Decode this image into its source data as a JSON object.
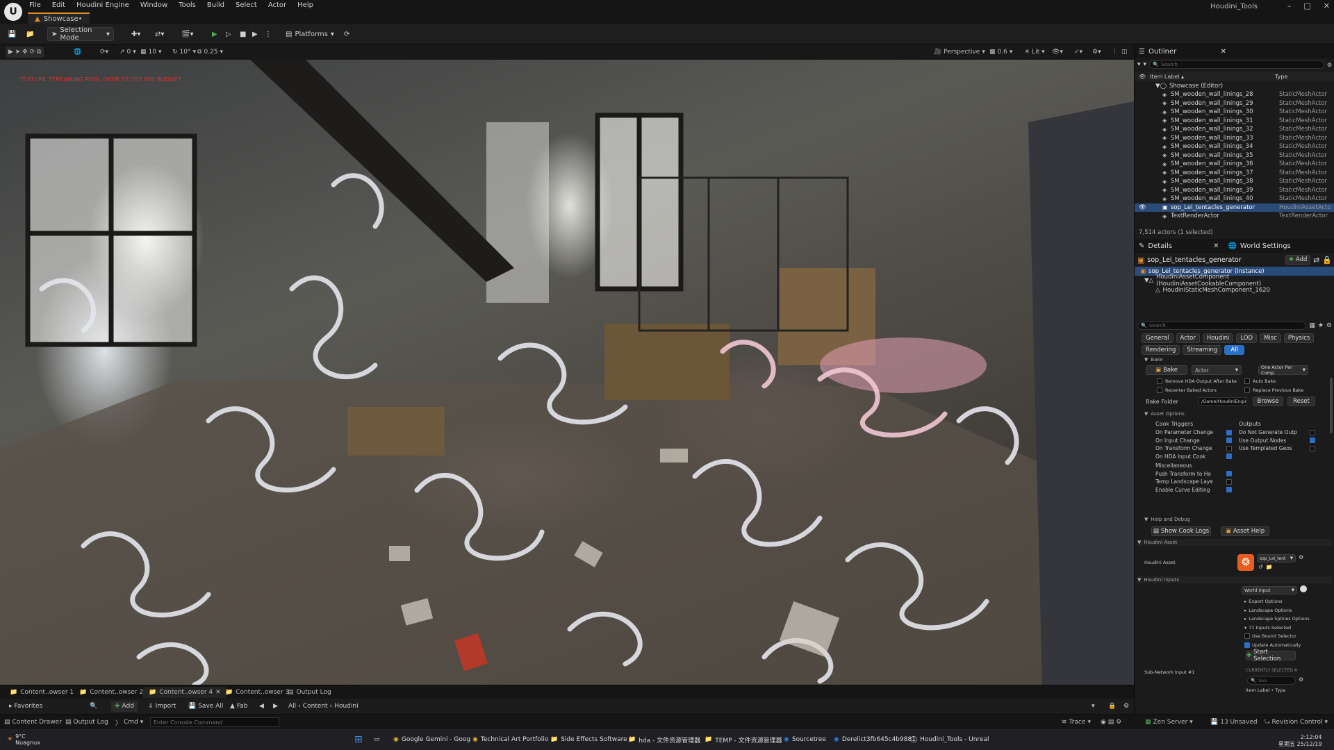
{
  "menubar": {
    "menus": [
      "File",
      "Edit",
      "Houdini Engine",
      "Window",
      "Tools",
      "Build",
      "Select",
      "Actor",
      "Help"
    ],
    "doc_tab": "Showcase•",
    "project": "Houdini_Tools"
  },
  "toolbar": {
    "selection_mode": "Selection Mode",
    "platforms": "Platforms"
  },
  "viewport_toolbar": {
    "grid": "10",
    "rot": "10°",
    "scale": "0.25",
    "translate": "0",
    "perspective": "Perspective",
    "speed": "0.6",
    "lit": "Lit"
  },
  "viewport": {
    "warning": "TEXTURE STREAMING POOL OVER 55.703 MiB BUDGET"
  },
  "bottom_tabs": [
    "Content..owser 1",
    "Content..owser 2",
    "Content..owser 4",
    "Content..owser 3",
    "Output Log"
  ],
  "content_bar": {
    "favorites": "Favorites",
    "add": "Add",
    "import": "Import",
    "save_all": "Save All",
    "fab": "Fab",
    "path": [
      "All",
      "Content",
      "Houdini"
    ]
  },
  "status": {
    "content_drawer": "Content Drawer",
    "output_log": "Output Log",
    "cmd": "Cmd",
    "console_placeholder": "Enter Console Command",
    "trace": "Trace",
    "zen": "Zen Server",
    "unsaved": "13 Unsaved",
    "revision": "Revision Control"
  },
  "taskbar": {
    "weather_temp": "9°C",
    "weather_place": "Nuagnux",
    "apps": [
      "Google Gemini - Goog",
      "Technical Art Portfolio",
      "Side Effects Software -",
      "hda - 文件资源管理器",
      "TEMP - 文件资源管理器",
      "Sourcetree",
      "Derelict3fb645c4b9881",
      "Houdini_Tools - Unreal"
    ],
    "time": "2:12:04",
    "date": "星期五 25/12/19"
  },
  "outliner": {
    "title": "Outliner",
    "search_placeholder": "Search",
    "col_label": "Item Label ▴",
    "col_type": "Type",
    "root": "Showcase (Editor)",
    "rows": [
      {
        "name": "SM_wooden_wall_linings_28",
        "type": "StaticMeshActor"
      },
      {
        "name": "SM_wooden_wall_linings_29",
        "type": "StaticMeshActor"
      },
      {
        "name": "SM_wooden_wall_linings_30",
        "type": "StaticMeshActor"
      },
      {
        "name": "SM_wooden_wall_linings_31",
        "type": "StaticMeshActor"
      },
      {
        "name": "SM_wooden_wall_linings_32",
        "type": "StaticMeshActor"
      },
      {
        "name": "SM_wooden_wall_linings_33",
        "type": "StaticMeshActor"
      },
      {
        "name": "SM_wooden_wall_linings_34",
        "type": "StaticMeshActor"
      },
      {
        "name": "SM_wooden_wall_linings_35",
        "type": "StaticMeshActor"
      },
      {
        "name": "SM_wooden_wall_linings_36",
        "type": "StaticMeshActor"
      },
      {
        "name": "SM_wooden_wall_linings_37",
        "type": "StaticMeshActor"
      },
      {
        "name": "SM_wooden_wall_linings_38",
        "type": "StaticMeshActor"
      },
      {
        "name": "SM_wooden_wall_linings_39",
        "type": "StaticMeshActor"
      },
      {
        "name": "SM_wooden_wall_linings_40",
        "type": "StaticMeshActor"
      },
      {
        "name": "sop_Lei_tentacles_generator",
        "type": "HoudiniAssetActo"
      },
      {
        "name": "TextRenderActor",
        "type": "TextRenderActor"
      }
    ],
    "count": "7,514 actors (1 selected)"
  },
  "details": {
    "tab": "Details",
    "tab2": "World Settings",
    "actor": "sop_Lei_tentacles_generator",
    "add": "Add",
    "instance": "sop_Lei_tentacles_generator (Instance)",
    "comp1": "HoudiniAssetComponent (HoudiniAssetCookableComponent)",
    "comp2": "HoudiniStaticMeshComponent_1620",
    "search_placeholder": "Search",
    "filters": [
      "General",
      "Actor",
      "Houdini",
      "LOD",
      "Misc",
      "Physics",
      "Rendering",
      "Streaming",
      "All"
    ],
    "bake": {
      "section": "Bake",
      "button": "Bake",
      "target": "Actor",
      "mode": "One Actor Per Comp",
      "remove": "Remove HDA Output After Bake",
      "auto": "Auto Bake",
      "recenter": "Recenter Baked Actors",
      "replace": "Replace Previous Bake",
      "folder_label": "Bake Folder",
      "folder": "/Game/HoudiniEngin",
      "browse": "Browse",
      "reset": "Reset"
    },
    "asset_options": {
      "section": "Asset Options",
      "cook_triggers": "Cook Triggers",
      "outputs": "Outputs",
      "left": [
        "On Parameter Change",
        "On Input Change",
        "On Transform Change",
        "On HDA Input Cook"
      ],
      "right": [
        "Do Not Generate Outp",
        "Use Output Nodes",
        "Use Templated Geos"
      ],
      "misc": "Miscellaneous",
      "misc_items": [
        "Push Transform to Ho",
        "Temp Landscape Laye",
        "Enable Curve Editing"
      ]
    },
    "help": {
      "section": "Help and Debug",
      "cook_logs": "Show Cook Logs",
      "asset_help": "Asset Help"
    },
    "houdini_asset": {
      "section": "Houdini Asset",
      "label": "Houdini Asset",
      "value": "sop_Lei_tent"
    },
    "inputs": {
      "section": "Houdini Inputs",
      "type": "World Input",
      "items": [
        "Export Options",
        "Landscape Options",
        "Landscape Splines Options",
        "71 Inputs Selected",
        "Use Bound Selector",
        "Update Automatically"
      ],
      "start": "Start Selection",
      "subnet": "Sub-Network Input #1",
      "currently": "CURRENTLY SELECTED A",
      "search": "Sea",
      "item_label": "Item Label • Type"
    }
  }
}
